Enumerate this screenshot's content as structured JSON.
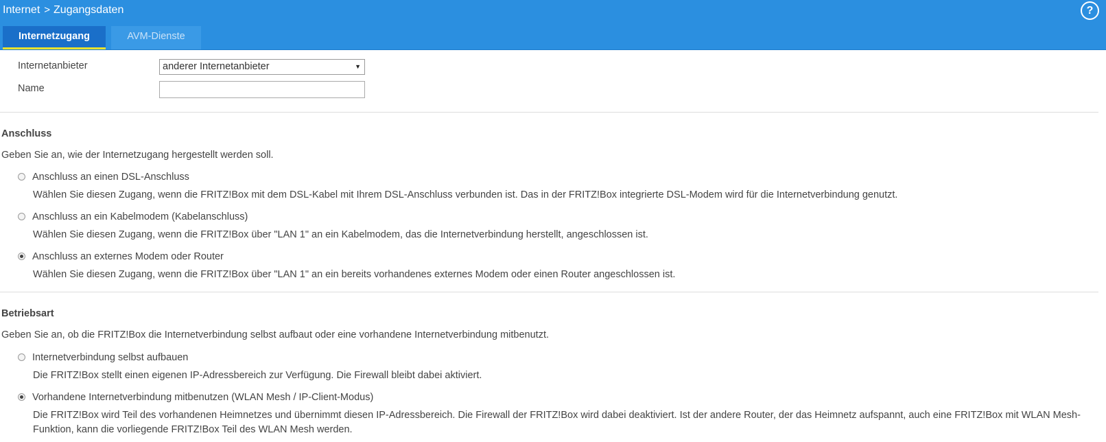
{
  "header": {
    "breadcrumb": [
      "Internet",
      "Zugangsdaten"
    ],
    "breadcrumb_separator": ">",
    "help_label": "?",
    "background_color": "#2b8fe0",
    "tabs": [
      {
        "label": "Internetzugang",
        "active": true
      },
      {
        "label": "AVM-Dienste",
        "active": false
      }
    ]
  },
  "form": {
    "provider_label": "Internetanbieter",
    "provider_value": "anderer Internetanbieter",
    "name_label": "Name",
    "name_value": ""
  },
  "anschluss": {
    "heading": "Anschluss",
    "intro": "Geben Sie an, wie der Internetzugang hergestellt werden soll.",
    "options": [
      {
        "label": "Anschluss an einen DSL-Anschluss",
        "description": "Wählen Sie diesen Zugang, wenn die FRITZ!Box mit dem DSL-Kabel mit Ihrem DSL-Anschluss verbunden ist. Das in der FRITZ!Box integrierte DSL-Modem wird für die Internetverbindung genutzt.",
        "checked": false
      },
      {
        "label": "Anschluss an ein Kabelmodem (Kabelanschluss)",
        "description": "Wählen Sie diesen Zugang, wenn die FRITZ!Box über \"LAN 1\" an ein Kabelmodem, das die Internetverbindung herstellt, angeschlossen ist.",
        "checked": false
      },
      {
        "label": "Anschluss an externes Modem oder Router",
        "description": "Wählen Sie diesen Zugang, wenn die FRITZ!Box über \"LAN 1\" an ein bereits vorhandenes externes Modem oder einen Router angeschlossen ist.",
        "checked": true
      }
    ]
  },
  "betriebsart": {
    "heading": "Betriebsart",
    "intro": "Geben Sie an, ob die FRITZ!Box die Internetverbindung selbst aufbaut oder eine vorhandene Internetverbindung mitbenutzt.",
    "options": [
      {
        "label": "Internetverbindung selbst aufbauen",
        "description": "Die FRITZ!Box stellt einen eigenen IP-Adressbereich zur Verfügung. Die Firewall bleibt dabei aktiviert.",
        "checked": false
      },
      {
        "label": "Vorhandene Internetverbindung mitbenutzen (WLAN Mesh / IP-Client-Modus)",
        "description": "Die FRITZ!Box wird Teil des vorhandenen Heimnetzes und übernimmt diesen IP-Adressbereich. Die Firewall der FRITZ!Box wird dabei deaktiviert. Ist der andere Router, der das Heimnetz aufspannt, auch eine FRITZ!Box mit WLAN Mesh-Funktion, kann die vorliegende FRITZ!Box Teil des WLAN Mesh werden.",
        "checked": true
      }
    ]
  }
}
